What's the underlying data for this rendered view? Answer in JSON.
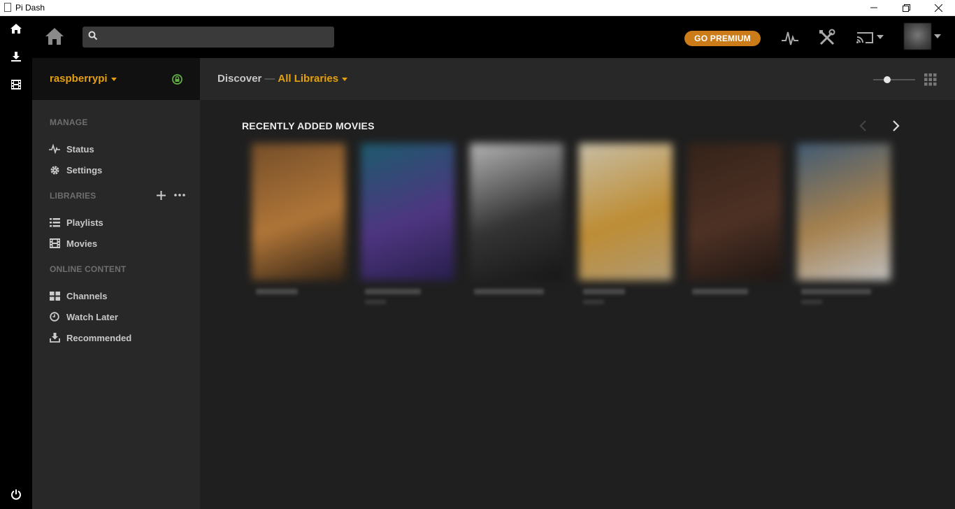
{
  "window": {
    "title": "Pi Dash"
  },
  "topbar": {
    "search_placeholder": "",
    "premium_label": "GO PREMIUM"
  },
  "sidebar": {
    "server_name": "raspberrypi",
    "manage_label": "MANAGE",
    "manage_items": [
      {
        "label": "Status",
        "icon": "activity-icon"
      },
      {
        "label": "Settings",
        "icon": "gear-icon"
      }
    ],
    "libraries_label": "LIBRARIES",
    "library_items": [
      {
        "label": "Playlists",
        "icon": "list-icon"
      },
      {
        "label": "Movies",
        "icon": "film-icon"
      }
    ],
    "online_label": "ONLINE CONTENT",
    "online_items": [
      {
        "label": "Channels",
        "icon": "grid-icon"
      },
      {
        "label": "Watch Later",
        "icon": "clock-icon"
      },
      {
        "label": "Recommended",
        "icon": "download-icon"
      }
    ]
  },
  "main": {
    "breadcrumb_root": "Discover",
    "breadcrumb_sep": "—",
    "breadcrumb_library": "All Libraries",
    "hub_title": "RECENTLY ADDED MOVIES"
  },
  "colors": {
    "accent": "#e5a00d",
    "premium": "#cc7b19",
    "lock": "#5fb040"
  },
  "posters": [
    {
      "gradient": [
        "#8a5a2c",
        "#d48b3e",
        "#3a2614"
      ]
    },
    {
      "gradient": [
        "#1c6a80",
        "#5a3c9a",
        "#2a1e56"
      ]
    },
    {
      "gradient": [
        "#d8d8d8",
        "#3a3a3a",
        "#141414"
      ]
    },
    {
      "gradient": [
        "#f2e6c8",
        "#e6a93a",
        "#d4b98a"
      ]
    },
    {
      "gradient": [
        "#3a2418",
        "#5a3626",
        "#1e1410"
      ]
    },
    {
      "gradient": [
        "#4a6a8a",
        "#c89a5a",
        "#e8e8e8"
      ]
    }
  ]
}
